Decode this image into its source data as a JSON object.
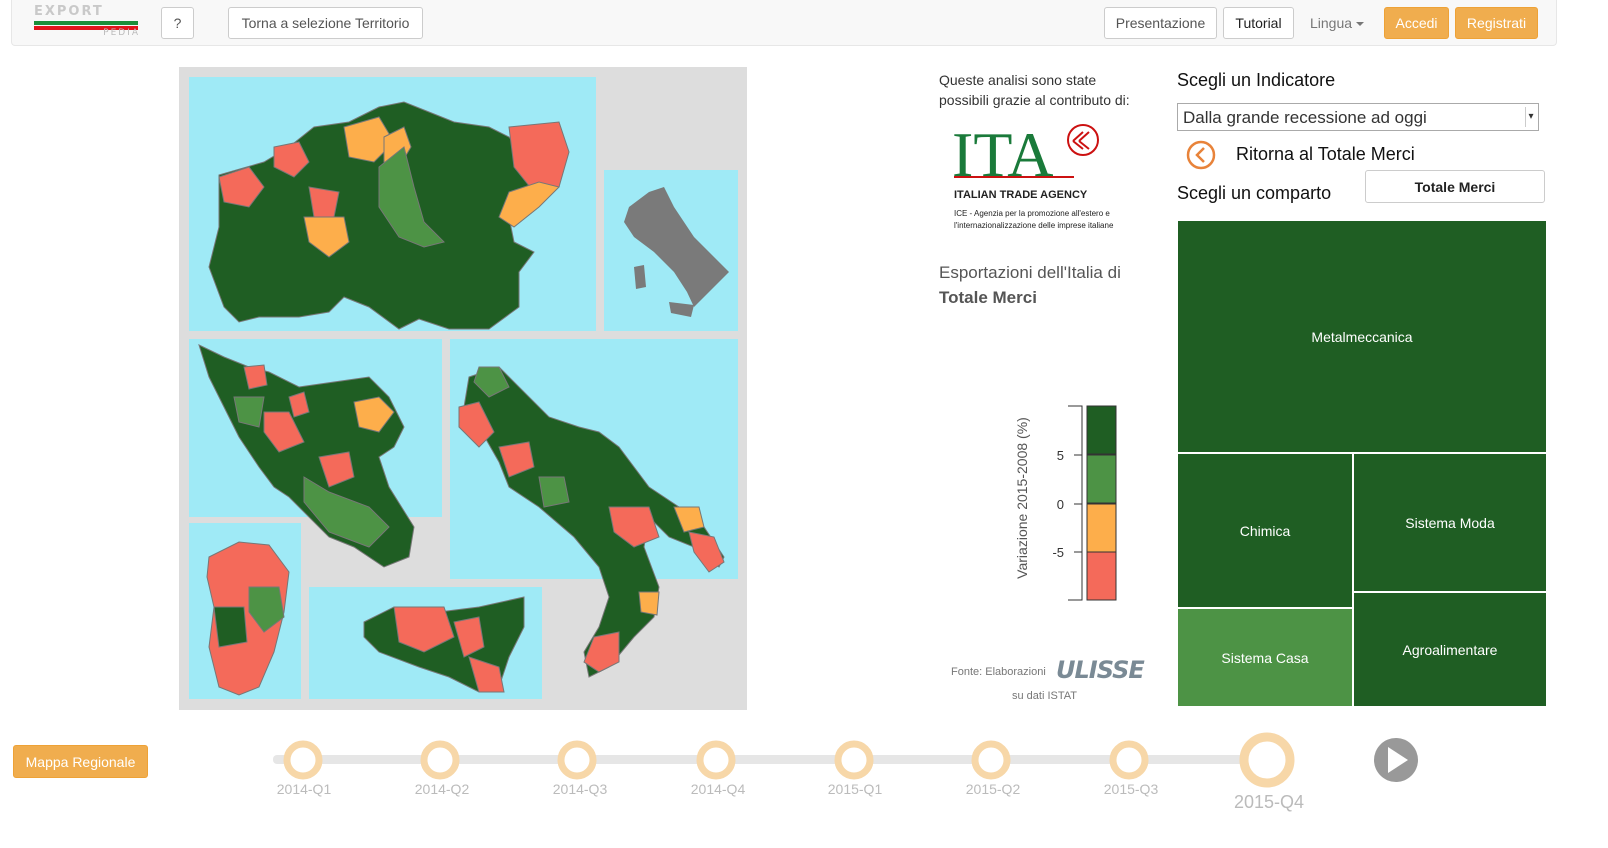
{
  "header": {
    "logo": {
      "top_text": "EXPORT",
      "bottom_text": "PEDIA"
    },
    "help_label": "?",
    "territory_label": "Torna a selezione Territorio",
    "presentazione_label": "Presentazione",
    "tutorial_label": "Tutorial",
    "lingua_label": "Lingua",
    "accedi_label": "Accedi",
    "registrati_label": "Registrati"
  },
  "credit": {
    "text": "Queste analisi sono state possibili grazie al contributo di:",
    "ita": {
      "big": "ITA",
      "agency": "ITALIAN TRADE AGENCY",
      "ice_line1": "ICE - Agenzia per la promozione all'estero e",
      "ice_line2": "l'internazionalizzazione delle imprese italiane"
    }
  },
  "export_title": {
    "line1": "Esportazioni dell'Italia di",
    "line2": "Totale Merci"
  },
  "legend": {
    "axis_label": "Variazione 2015-2008 (%)",
    "ticks": [
      "5",
      "0",
      "-5"
    ],
    "colors": [
      "#1f5e23",
      "#4d9345",
      "#fdae4b",
      "#f46a5a"
    ]
  },
  "fonte": {
    "prefix": "Fonte: Elaborazioni",
    "brand": "ULISSE",
    "suffix": "su dati ISTAT"
  },
  "indicator": {
    "title": "Scegli un Indicatore",
    "selected": "Dalla grande recessione ad oggi",
    "back_label": "Ritorna al Totale Merci",
    "comparto_title": "Scegli un comparto",
    "comparto_selected": "Totale Merci"
  },
  "treemap": [
    {
      "label": "Metalmeccanica",
      "color": "#1f5e23"
    },
    {
      "label": "Chimica",
      "color": "#1f5e23"
    },
    {
      "label": "Sistema Moda",
      "color": "#1f5e23"
    },
    {
      "label": "Sistema Casa",
      "color": "#4d9345"
    },
    {
      "label": "Agroalimentare",
      "color": "#1f5e23"
    }
  ],
  "map": {
    "sea_color": "#9feaf6",
    "panel_color": "#dddddd",
    "inset_italy_color": "#7a7a7a"
  },
  "footer": {
    "mappa_label": "Mappa Regionale",
    "quarters": [
      "2014-Q1",
      "2014-Q2",
      "2014-Q3",
      "2014-Q4",
      "2015-Q1",
      "2015-Q2",
      "2015-Q3",
      "2015-Q4"
    ],
    "active_quarter": "2015-Q4"
  }
}
